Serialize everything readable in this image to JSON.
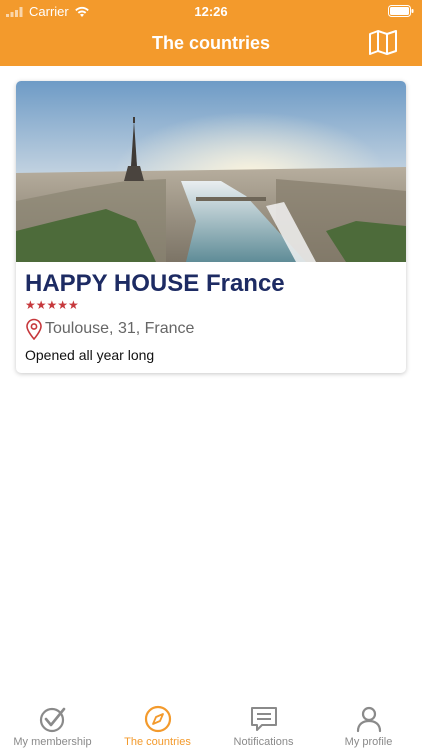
{
  "status": {
    "carrier": "Carrier",
    "time": "12:26"
  },
  "header": {
    "title": "The countries",
    "map_icon": "map-icon"
  },
  "card": {
    "title": "HAPPY HOUSE France",
    "stars": "★★★★★",
    "rating": 5,
    "location": "Toulouse, 31, France",
    "opening": "Opened all year long"
  },
  "tabs": [
    {
      "label": "My membership",
      "icon": "check-circle-icon"
    },
    {
      "label": "The countries",
      "icon": "compass-icon"
    },
    {
      "label": "Notifications",
      "icon": "message-icon"
    },
    {
      "label": "My profile",
      "icon": "person-icon"
    }
  ],
  "colors": {
    "accent": "#F39A2C",
    "title": "#1D2B63",
    "stars": "#C6383C",
    "inactive": "#8a8a8a"
  }
}
